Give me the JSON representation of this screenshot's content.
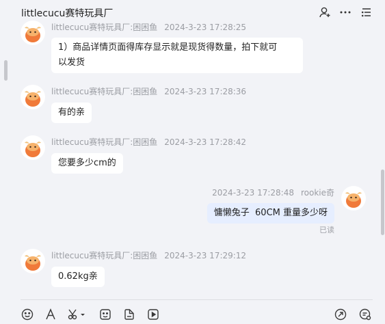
{
  "header": {
    "title": "littlecucu赛特玩具厂",
    "icons": [
      "add-contact-icon",
      "more-icon",
      "list-icon"
    ]
  },
  "messages": [
    {
      "sender": "littlecucu赛特玩具厂:困困鱼",
      "time": "2024-3-23 17:28:25",
      "lines": [
        "1）商品详情页面得库存显示就是现货得数量，拍下就可",
        "以发货"
      ]
    },
    {
      "sender": "littlecucu赛特玩具厂:困困鱼",
      "time": "2024-3-23 17:28:36",
      "lines": [
        "有的亲"
      ]
    },
    {
      "sender": "littlecucu赛特玩具厂:困困鱼",
      "time": "2024-3-23 17:28:42",
      "lines": [
        "您要多少cm的"
      ]
    },
    {
      "sender": "rookie奇",
      "time": "2024-3-23 17:28:48",
      "lines": [
        "慵懒兔子  60CM 重量多少呀"
      ],
      "status": "已读"
    },
    {
      "sender": "littlecucu赛特玩具厂:困困鱼",
      "time": "2024-3-23 17:29:12",
      "lines": [
        "0.62kg亲"
      ]
    }
  ],
  "toolbar": {
    "icons": [
      "emoji-icon",
      "font-icon",
      "scissors-icon",
      "sticker-icon",
      "file-icon",
      "video-icon",
      "send-share-icon",
      "settings-chat-icon"
    ]
  }
}
